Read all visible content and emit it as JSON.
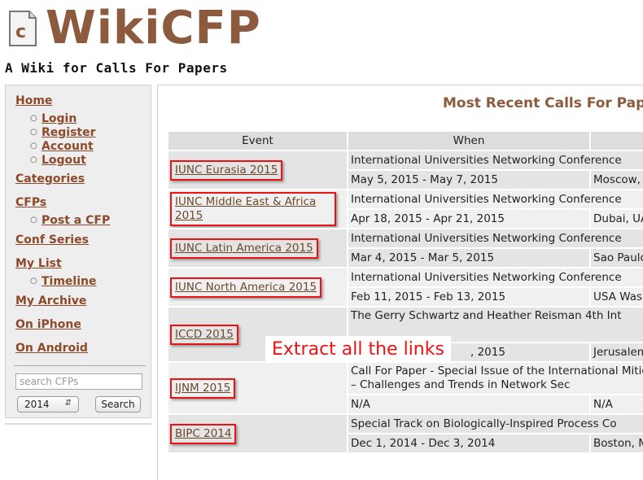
{
  "header": {
    "logo_letter": "c",
    "site_name": "WikiCFP",
    "tagline": "A Wiki for Calls For Papers"
  },
  "sidebar": {
    "home": "Home",
    "login": "Login",
    "register": "Register",
    "account": "Account",
    "logout": "Logout",
    "categories": "Categories",
    "cfps": "CFPs",
    "post_cfp": "Post a CFP",
    "conf_series": "Conf Series",
    "my_list": "My List",
    "timeline": "Timeline",
    "my_archive": "My Archive",
    "on_iphone": "On iPhone",
    "on_android": "On Android",
    "search_placeholder": "search CFPs",
    "year_selected": "2014",
    "search_button": "Search"
  },
  "main": {
    "title": "Most Recent Calls For Pap",
    "columns": [
      "Event",
      "When",
      ""
    ],
    "rows": [
      {
        "event": "IUNC Eurasia 2015",
        "title": "International Universities Networking Conference",
        "when": "May 5, 2015 - May 7, 2015",
        "where": "Moscow, R"
      },
      {
        "event": "IUNC Middle East & Africa 2015",
        "title": "International Universities Networking Conference",
        "when": "Apr 18, 2015 - Apr 21, 2015",
        "where": "Dubai, UA"
      },
      {
        "event": "IUNC Latin America 2015",
        "title": "International Universities Networking Conference",
        "when": "Mar 4, 2015 - Mar 5, 2015",
        "where": "Sao Paulo"
      },
      {
        "event": "IUNC North America 2015",
        "title": "International Universities Networking Conference",
        "when": "Feb 11, 2015 - Feb 13, 2015",
        "where": "USA Wash"
      },
      {
        "event": "ICCD 2015",
        "title": "The Gerry Schwartz and Heather Reisman 4th Int",
        "when": ", 2015",
        "where": "Jerusalem"
      },
      {
        "event": "IJNM 2015",
        "title": "Call For Paper - Special Issue of the International\nMitigate – Challenges and Trends in Network Sec",
        "when": "N/A",
        "where": "N/A"
      },
      {
        "event": "BIPC 2014",
        "title": "Special Track on Biologically-Inspired Process Co",
        "when": "Dec 1, 2014 - Dec 3, 2014",
        "where": "Boston, M"
      }
    ]
  },
  "overlay_text": "Extract all the links",
  "colors": {
    "brand_brown": "#8c5a3c",
    "link_brown": "#8c4a2a",
    "highlight_red": "#ee1111"
  }
}
